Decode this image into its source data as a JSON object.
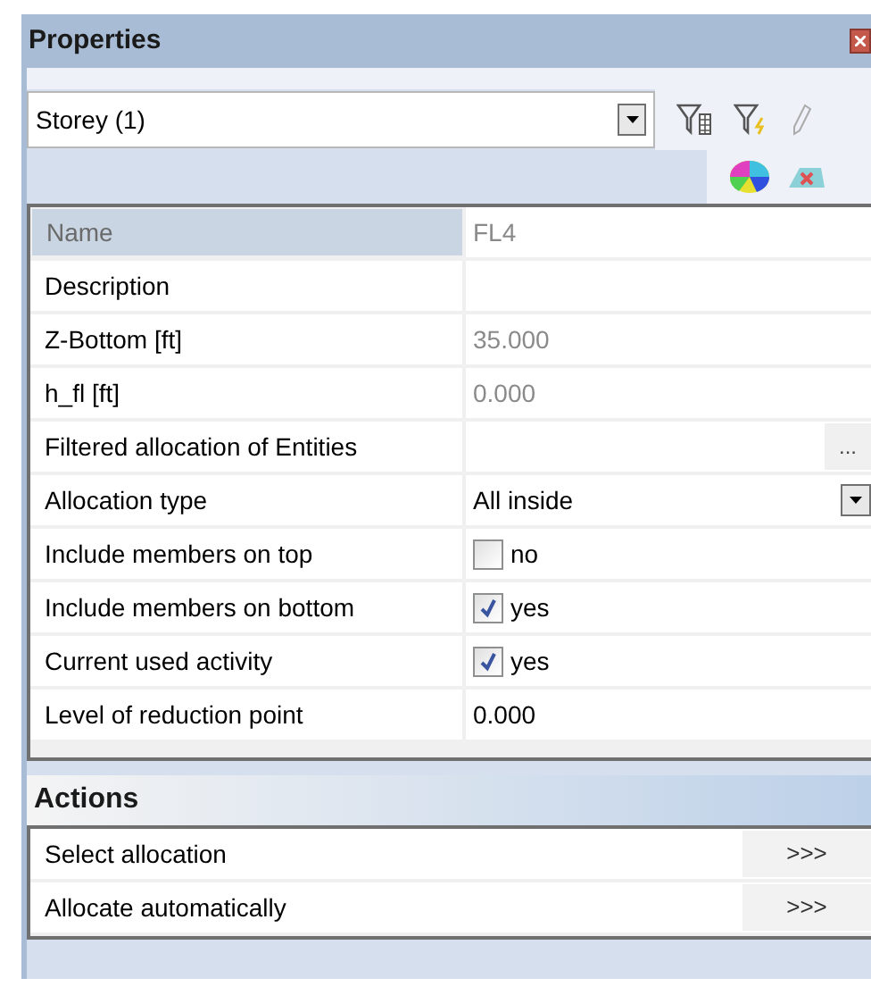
{
  "window": {
    "title": "Properties"
  },
  "selector": {
    "value": "Storey (1)"
  },
  "properties": [
    {
      "kind": "text",
      "label": "Name",
      "value": "FL4",
      "readonly": true,
      "selected": true
    },
    {
      "kind": "text",
      "label": "Description",
      "selected": false
    },
    {
      "kind": "text",
      "label": "Z-Bottom [ft]",
      "value": "35.000",
      "readonly": true,
      "selected": false
    },
    {
      "kind": "text",
      "label": "h_fl [ft]",
      "value": "0.000",
      "readonly": true,
      "selected": false
    },
    {
      "kind": "browse",
      "label": "Filtered allocation of Entities",
      "button": "...",
      "selected": false
    },
    {
      "kind": "dropdown",
      "label": "Allocation type",
      "value": "All inside",
      "readonly": false,
      "selected": false
    },
    {
      "kind": "checkbox",
      "label": "Include members on top",
      "value": "no",
      "checked": false,
      "readonly": false,
      "selected": false
    },
    {
      "kind": "checkbox",
      "label": "Include members on bottom",
      "value": "yes",
      "checked": true,
      "readonly": false,
      "selected": false
    },
    {
      "kind": "checkbox",
      "label": "Current used activity",
      "value": "yes",
      "checked": true,
      "readonly": false,
      "selected": false
    },
    {
      "kind": "text",
      "label": "Level of reduction point",
      "value": "0.000",
      "readonly": false,
      "selected": false
    }
  ],
  "actions": {
    "title": "Actions",
    "items": [
      {
        "label": "Select allocation",
        "button": ">>>"
      },
      {
        "label": "Allocate automatically",
        "button": ">>>"
      }
    ]
  }
}
